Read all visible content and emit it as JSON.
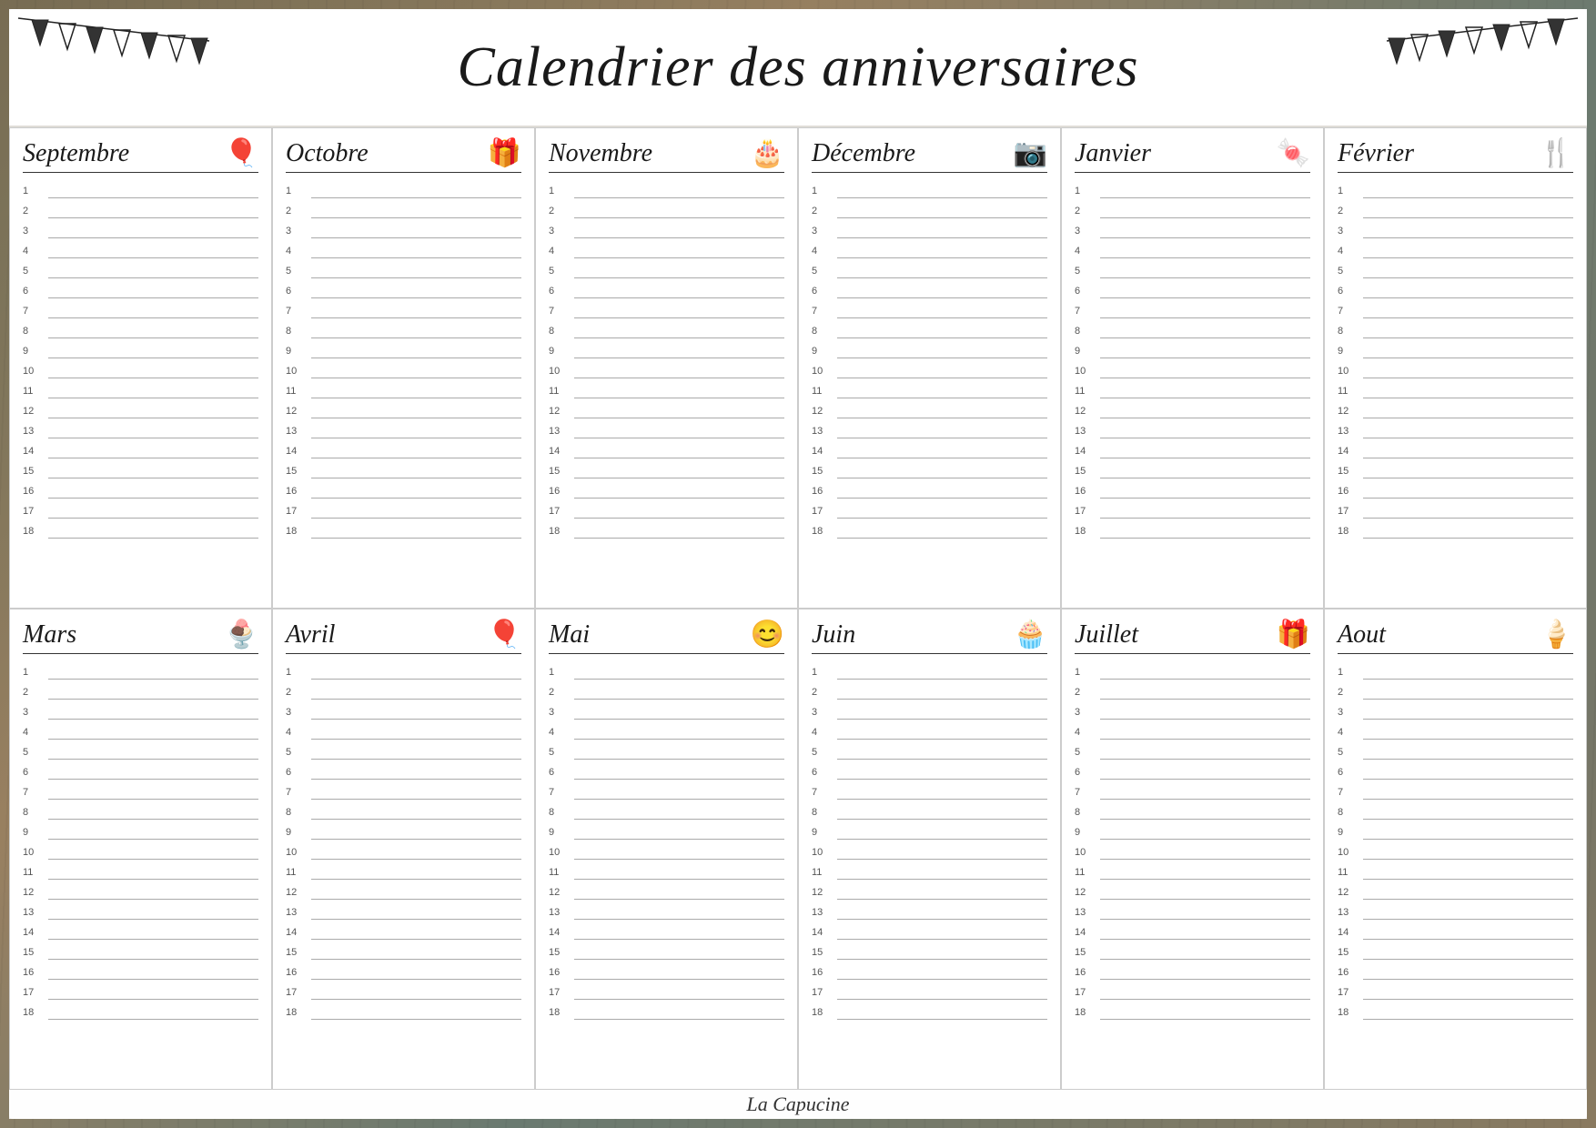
{
  "title": "Calendrier des anniversaires",
  "footer": "La Capucine",
  "months": [
    {
      "name": "Septembre",
      "icon": "🎈",
      "iconLabel": "balloons-icon"
    },
    {
      "name": "Octobre",
      "icon": "🎁",
      "iconLabel": "gift-icon"
    },
    {
      "name": "Novembre",
      "icon": "🎂",
      "iconLabel": "cake-icon"
    },
    {
      "name": "Décembre",
      "icon": "📷",
      "iconLabel": "camera-icon"
    },
    {
      "name": "Janvier",
      "icon": "🍬",
      "iconLabel": "candy-icon"
    },
    {
      "name": "Février",
      "icon": "🍴",
      "iconLabel": "cutlery-icon"
    },
    {
      "name": "Mars",
      "icon": "🍨",
      "iconLabel": "icecream-icon"
    },
    {
      "name": "Avril",
      "icon": "🎈",
      "iconLabel": "balloon-icon"
    },
    {
      "name": "Mai",
      "icon": "😊",
      "iconLabel": "smiley-icon"
    },
    {
      "name": "Juin",
      "icon": "🧁",
      "iconLabel": "cupcake-icon"
    },
    {
      "name": "Juillet",
      "icon": "🎁",
      "iconLabel": "gift2-icon"
    },
    {
      "name": "Aout",
      "icon": "🍦",
      "iconLabel": "softserve-icon"
    }
  ],
  "num_lines": 18
}
